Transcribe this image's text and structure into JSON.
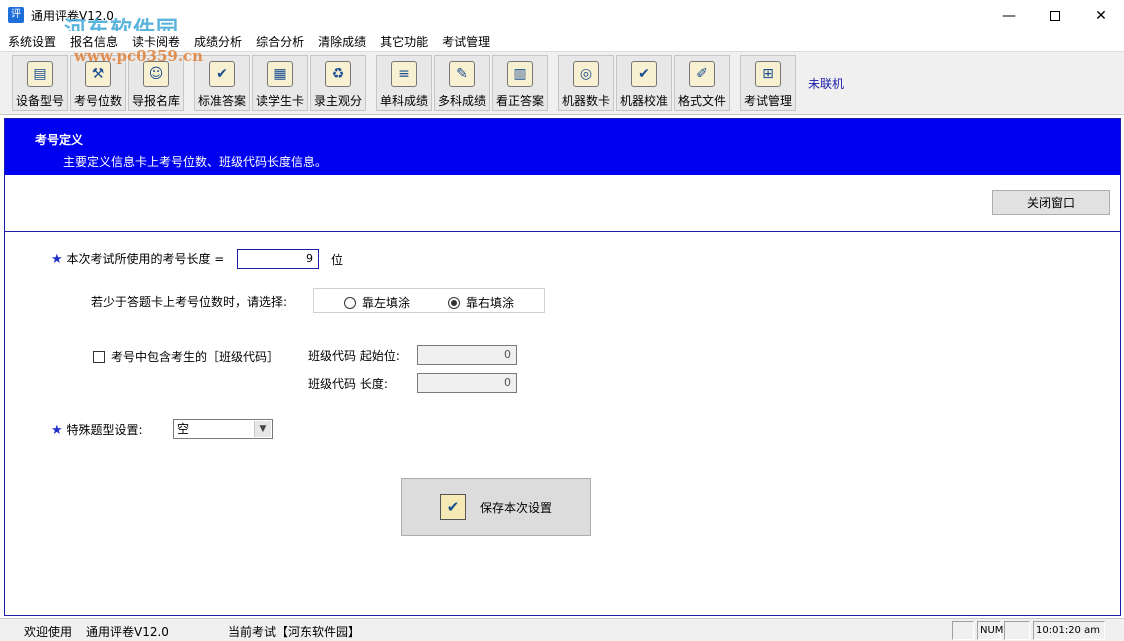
{
  "window": {
    "title": "通用评卷V12.0",
    "icon_char": "评",
    "watermark": "河东软件园",
    "watermark_url": "www.pc0359.cn"
  },
  "menu": [
    "系统设置",
    "报名信息",
    "读卡阅卷",
    "成绩分析",
    "综合分析",
    "清除成绩",
    "其它功能",
    "考试管理"
  ],
  "toolbar": {
    "buttons": [
      {
        "label": "设备型号",
        "icon": "device-icon",
        "glyph": "▤"
      },
      {
        "label": "考号位数",
        "icon": "hammer-icon",
        "glyph": "⚒"
      },
      {
        "label": "导报名库",
        "icon": "person-icon",
        "glyph": "☺"
      },
      {
        "label": "标准答案",
        "icon": "checkmark-icon",
        "glyph": "✔"
      },
      {
        "label": "读学生卡",
        "icon": "card-reader-icon",
        "glyph": "▦"
      },
      {
        "label": "录主观分",
        "icon": "recycle-icon",
        "glyph": "♻"
      },
      {
        "label": "单科成绩",
        "icon": "document-icon",
        "glyph": "≡"
      },
      {
        "label": "多科成绩",
        "icon": "edit-icon",
        "glyph": "✎"
      },
      {
        "label": "看正答案",
        "icon": "notebook-icon",
        "glyph": "▥"
      },
      {
        "label": "机器数卡",
        "icon": "film-reel-icon",
        "glyph": "◎"
      },
      {
        "label": "机器校准",
        "icon": "checkmark-icon",
        "glyph": "✔"
      },
      {
        "label": "格式文件",
        "icon": "pen-icon",
        "glyph": "✐"
      },
      {
        "label": "考试管理",
        "icon": "windows-icon",
        "glyph": "⊞"
      }
    ],
    "status": "未联机"
  },
  "panel": {
    "title": "考号定义",
    "description": "主要定义信息卡上考号位数、班级代码长度信息。",
    "close_button": "关闭窗口",
    "star": "★",
    "exam_length_label": "本次考试所使用的考号长度 =",
    "exam_length_value": "9",
    "exam_length_unit": "位",
    "fill_prompt": "若少于答题卡上考号位数时，请选择:",
    "fill_options": [
      {
        "label": "靠左填涂",
        "selected": false
      },
      {
        "label": "靠右填涂",
        "selected": true
      }
    ],
    "class_code_checkbox": "考号中包含考生的［班级代码］",
    "class_code_checked": false,
    "class_start_label": "班级代码 起始位:",
    "class_start_value": "0",
    "class_length_label": "班级代码 长度:",
    "class_length_value": "0",
    "special_label": "特殊题型设置:",
    "special_value": "空",
    "save_button": "保存本次设置"
  },
  "statusbar": {
    "welcome": "欢迎使用",
    "app_name": "通用评卷V12.0",
    "current_exam": "当前考试【河东软件园】",
    "num": "NUM",
    "time": "10:01:20 am"
  }
}
